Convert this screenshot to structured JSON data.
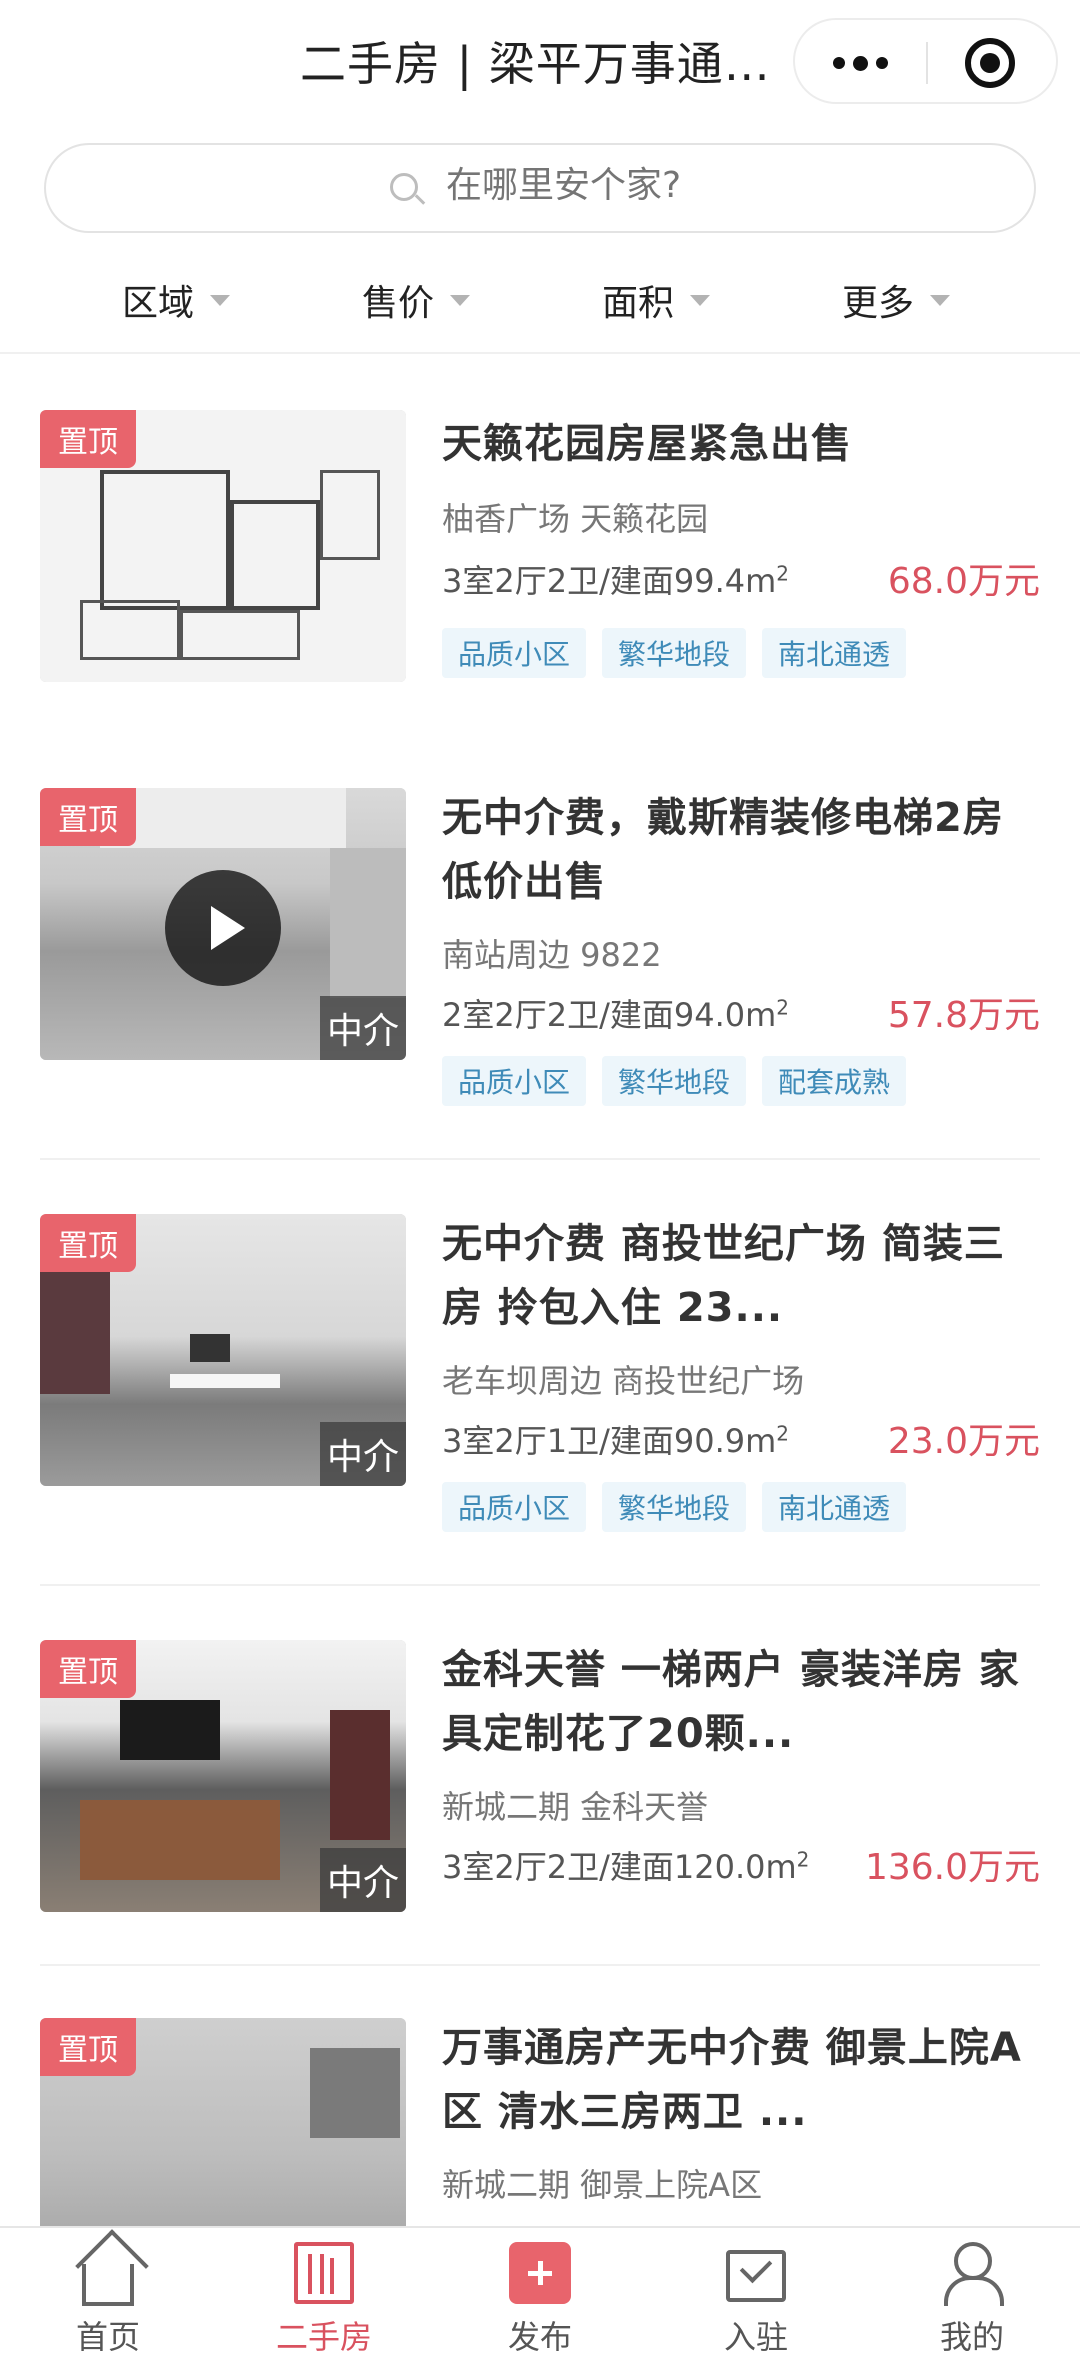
{
  "header": {
    "title": "二手房 | 梁平万事通小程序"
  },
  "search": {
    "placeholder": "在哪里安个家?"
  },
  "filters": [
    {
      "label": "区域"
    },
    {
      "label": "售价"
    },
    {
      "label": "面积"
    },
    {
      "label": "更多"
    }
  ],
  "listings": [
    {
      "badge": "置顶",
      "title": "天籁花园房屋紧急出售",
      "location": "柚香广场 天籁花园",
      "spec": "3室2厅2卫/建面99.4m",
      "spec_sup": "2",
      "price": "68.0万元",
      "tags": [
        "品质小区",
        "繁华地段",
        "南北通透"
      ]
    },
    {
      "badge": "置顶",
      "agent": "中介",
      "title": "无中介费，戴斯精装修电梯2房低价出售",
      "location": "南站周边 9822",
      "spec": "2室2厅2卫/建面94.0m",
      "spec_sup": "2",
      "price": "57.8万元",
      "tags": [
        "品质小区",
        "繁华地段",
        "配套成熟"
      ]
    },
    {
      "badge": "置顶",
      "agent": "中介",
      "title": "无中介费 商投世纪广场 简装三房 拎包入住 23...",
      "location": "老车坝周边 商投世纪广场",
      "spec": "3室2厅1卫/建面90.9m",
      "spec_sup": "2",
      "price": "23.0万元",
      "tags": [
        "品质小区",
        "繁华地段",
        "南北通透"
      ]
    },
    {
      "badge": "置顶",
      "agent": "中介",
      "title": "金科天誉 一梯两户 豪装洋房 家具定制花了20颗...",
      "location": "新城二期 金科天誉",
      "spec": "3室2厅2卫/建面120.0m",
      "spec_sup": "2",
      "price": "136.0万元",
      "tags": []
    },
    {
      "badge": "置顶",
      "title": "万事通房产无中介费 御景上院A区 清水三房两卫 ...",
      "location": "新城二期 御景上院A区",
      "spec": "",
      "spec_sup": "",
      "price": "",
      "tags": []
    }
  ],
  "tabbar": [
    {
      "label": "首页",
      "icon": "home-icon"
    },
    {
      "label": "二手房",
      "icon": "building-icon"
    },
    {
      "label": "发布",
      "icon": "plus-icon"
    },
    {
      "label": "入驻",
      "icon": "mail-icon"
    },
    {
      "label": "我的",
      "icon": "user-icon"
    }
  ],
  "colors": {
    "accent": "#d9525f",
    "badge": "#e8646c",
    "tag_bg": "#edf6fb",
    "tag_text": "#3f8bb8"
  }
}
